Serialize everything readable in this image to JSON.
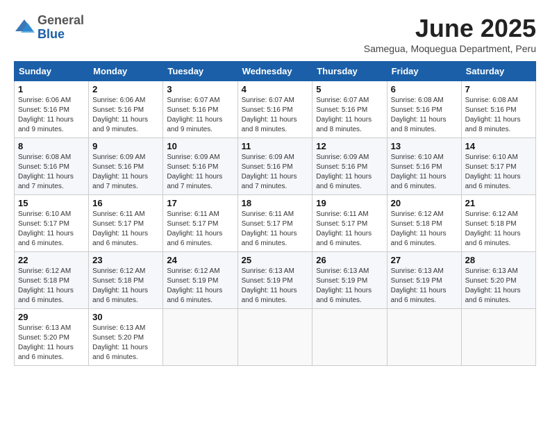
{
  "logo": {
    "general": "General",
    "blue": "Blue"
  },
  "title": "June 2025",
  "location": "Samegua, Moquegua Department, Peru",
  "days_header": [
    "Sunday",
    "Monday",
    "Tuesday",
    "Wednesday",
    "Thursday",
    "Friday",
    "Saturday"
  ],
  "weeks": [
    [
      {
        "num": "1",
        "info": "Sunrise: 6:06 AM\nSunset: 5:16 PM\nDaylight: 11 hours\nand 9 minutes."
      },
      {
        "num": "2",
        "info": "Sunrise: 6:06 AM\nSunset: 5:16 PM\nDaylight: 11 hours\nand 9 minutes."
      },
      {
        "num": "3",
        "info": "Sunrise: 6:07 AM\nSunset: 5:16 PM\nDaylight: 11 hours\nand 9 minutes."
      },
      {
        "num": "4",
        "info": "Sunrise: 6:07 AM\nSunset: 5:16 PM\nDaylight: 11 hours\nand 8 minutes."
      },
      {
        "num": "5",
        "info": "Sunrise: 6:07 AM\nSunset: 5:16 PM\nDaylight: 11 hours\nand 8 minutes."
      },
      {
        "num": "6",
        "info": "Sunrise: 6:08 AM\nSunset: 5:16 PM\nDaylight: 11 hours\nand 8 minutes."
      },
      {
        "num": "7",
        "info": "Sunrise: 6:08 AM\nSunset: 5:16 PM\nDaylight: 11 hours\nand 8 minutes."
      }
    ],
    [
      {
        "num": "8",
        "info": "Sunrise: 6:08 AM\nSunset: 5:16 PM\nDaylight: 11 hours\nand 7 minutes."
      },
      {
        "num": "9",
        "info": "Sunrise: 6:09 AM\nSunset: 5:16 PM\nDaylight: 11 hours\nand 7 minutes."
      },
      {
        "num": "10",
        "info": "Sunrise: 6:09 AM\nSunset: 5:16 PM\nDaylight: 11 hours\nand 7 minutes."
      },
      {
        "num": "11",
        "info": "Sunrise: 6:09 AM\nSunset: 5:16 PM\nDaylight: 11 hours\nand 7 minutes."
      },
      {
        "num": "12",
        "info": "Sunrise: 6:09 AM\nSunset: 5:16 PM\nDaylight: 11 hours\nand 6 minutes."
      },
      {
        "num": "13",
        "info": "Sunrise: 6:10 AM\nSunset: 5:16 PM\nDaylight: 11 hours\nand 6 minutes."
      },
      {
        "num": "14",
        "info": "Sunrise: 6:10 AM\nSunset: 5:17 PM\nDaylight: 11 hours\nand 6 minutes."
      }
    ],
    [
      {
        "num": "15",
        "info": "Sunrise: 6:10 AM\nSunset: 5:17 PM\nDaylight: 11 hours\nand 6 minutes."
      },
      {
        "num": "16",
        "info": "Sunrise: 6:11 AM\nSunset: 5:17 PM\nDaylight: 11 hours\nand 6 minutes."
      },
      {
        "num": "17",
        "info": "Sunrise: 6:11 AM\nSunset: 5:17 PM\nDaylight: 11 hours\nand 6 minutes."
      },
      {
        "num": "18",
        "info": "Sunrise: 6:11 AM\nSunset: 5:17 PM\nDaylight: 11 hours\nand 6 minutes."
      },
      {
        "num": "19",
        "info": "Sunrise: 6:11 AM\nSunset: 5:17 PM\nDaylight: 11 hours\nand 6 minutes."
      },
      {
        "num": "20",
        "info": "Sunrise: 6:12 AM\nSunset: 5:18 PM\nDaylight: 11 hours\nand 6 minutes."
      },
      {
        "num": "21",
        "info": "Sunrise: 6:12 AM\nSunset: 5:18 PM\nDaylight: 11 hours\nand 6 minutes."
      }
    ],
    [
      {
        "num": "22",
        "info": "Sunrise: 6:12 AM\nSunset: 5:18 PM\nDaylight: 11 hours\nand 6 minutes."
      },
      {
        "num": "23",
        "info": "Sunrise: 6:12 AM\nSunset: 5:18 PM\nDaylight: 11 hours\nand 6 minutes."
      },
      {
        "num": "24",
        "info": "Sunrise: 6:12 AM\nSunset: 5:19 PM\nDaylight: 11 hours\nand 6 minutes."
      },
      {
        "num": "25",
        "info": "Sunrise: 6:13 AM\nSunset: 5:19 PM\nDaylight: 11 hours\nand 6 minutes."
      },
      {
        "num": "26",
        "info": "Sunrise: 6:13 AM\nSunset: 5:19 PM\nDaylight: 11 hours\nand 6 minutes."
      },
      {
        "num": "27",
        "info": "Sunrise: 6:13 AM\nSunset: 5:19 PM\nDaylight: 11 hours\nand 6 minutes."
      },
      {
        "num": "28",
        "info": "Sunrise: 6:13 AM\nSunset: 5:20 PM\nDaylight: 11 hours\nand 6 minutes."
      }
    ],
    [
      {
        "num": "29",
        "info": "Sunrise: 6:13 AM\nSunset: 5:20 PM\nDaylight: 11 hours\nand 6 minutes."
      },
      {
        "num": "30",
        "info": "Sunrise: 6:13 AM\nSunset: 5:20 PM\nDaylight: 11 hours\nand 6 minutes."
      },
      null,
      null,
      null,
      null,
      null
    ]
  ]
}
